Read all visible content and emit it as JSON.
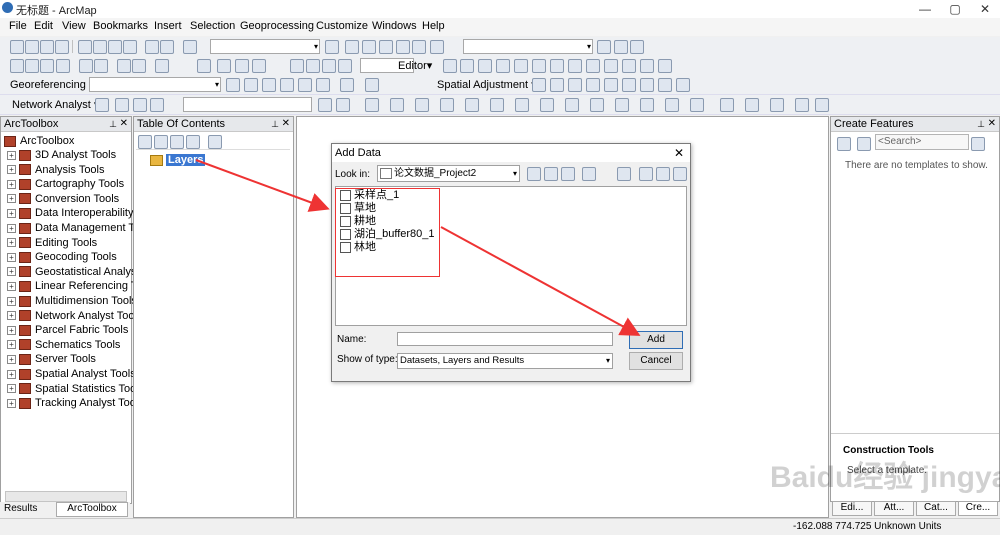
{
  "window": {
    "title": "无标题 - ArcMap",
    "minimize": "—",
    "maximize": "▢",
    "close": "✕"
  },
  "menu": [
    "File",
    "Edit",
    "View",
    "Bookmarks",
    "Insert",
    "Selection",
    "Geoprocessing",
    "Customize",
    "Windows",
    "Help"
  ],
  "toolbars": {
    "editor_label": "Editor▾",
    "georef_label": "Georeferencing ▾",
    "spatial_adj_label": "Spatial Adjustment ▾",
    "network_label": "Network Analyst ▾"
  },
  "arctoolbox": {
    "title": "ArcToolbox",
    "root": "ArcToolbox",
    "items": [
      "3D Analyst Tools",
      "Analysis Tools",
      "Cartography Tools",
      "Conversion Tools",
      "Data Interoperability T",
      "Data Management Too",
      "Editing Tools",
      "Geocoding Tools",
      "Geostatistical Analyst T",
      "Linear Referencing Too",
      "Multidimension Tools",
      "Network Analyst Tools",
      "Parcel Fabric Tools",
      "Schematics Tools",
      "Server Tools",
      "Spatial Analyst Tools",
      "Spatial Statistics Tools",
      "Tracking Analyst Tools"
    ],
    "tabs": [
      "Results",
      "ArcToolbox"
    ]
  },
  "toc": {
    "title": "Table Of Contents",
    "layer": "Layers"
  },
  "create_features": {
    "title": "Create Features",
    "search_placeholder": "<Search>",
    "empty_msg": "There are no templates to show.",
    "construction_title": "Construction Tools",
    "construction_msg": "Select a template.",
    "tabs": [
      "Edi...",
      "Att...",
      "Cat...",
      "Cre..."
    ]
  },
  "dialog": {
    "title": "Add Data",
    "look_in_label": "Look in:",
    "look_in_value": "论文数据_Project2",
    "files": [
      "采样点_1",
      "草地",
      "耕地",
      "湖泊_buffer80_1",
      "林地"
    ],
    "name_label": "Name:",
    "name_value": "",
    "type_label": "Show of type:",
    "type_value": "Datasets, Layers and Results",
    "add_button": "Add",
    "cancel_button": "Cancel"
  },
  "status": {
    "coords": "-162.088  774.725 Unknown Units"
  },
  "watermark": "Baidu经验 jingyan.baidu.com",
  "colors": {
    "annotation": "#e83333",
    "toolbox_icon": "#b0412a",
    "accent": "#2f6db5"
  }
}
